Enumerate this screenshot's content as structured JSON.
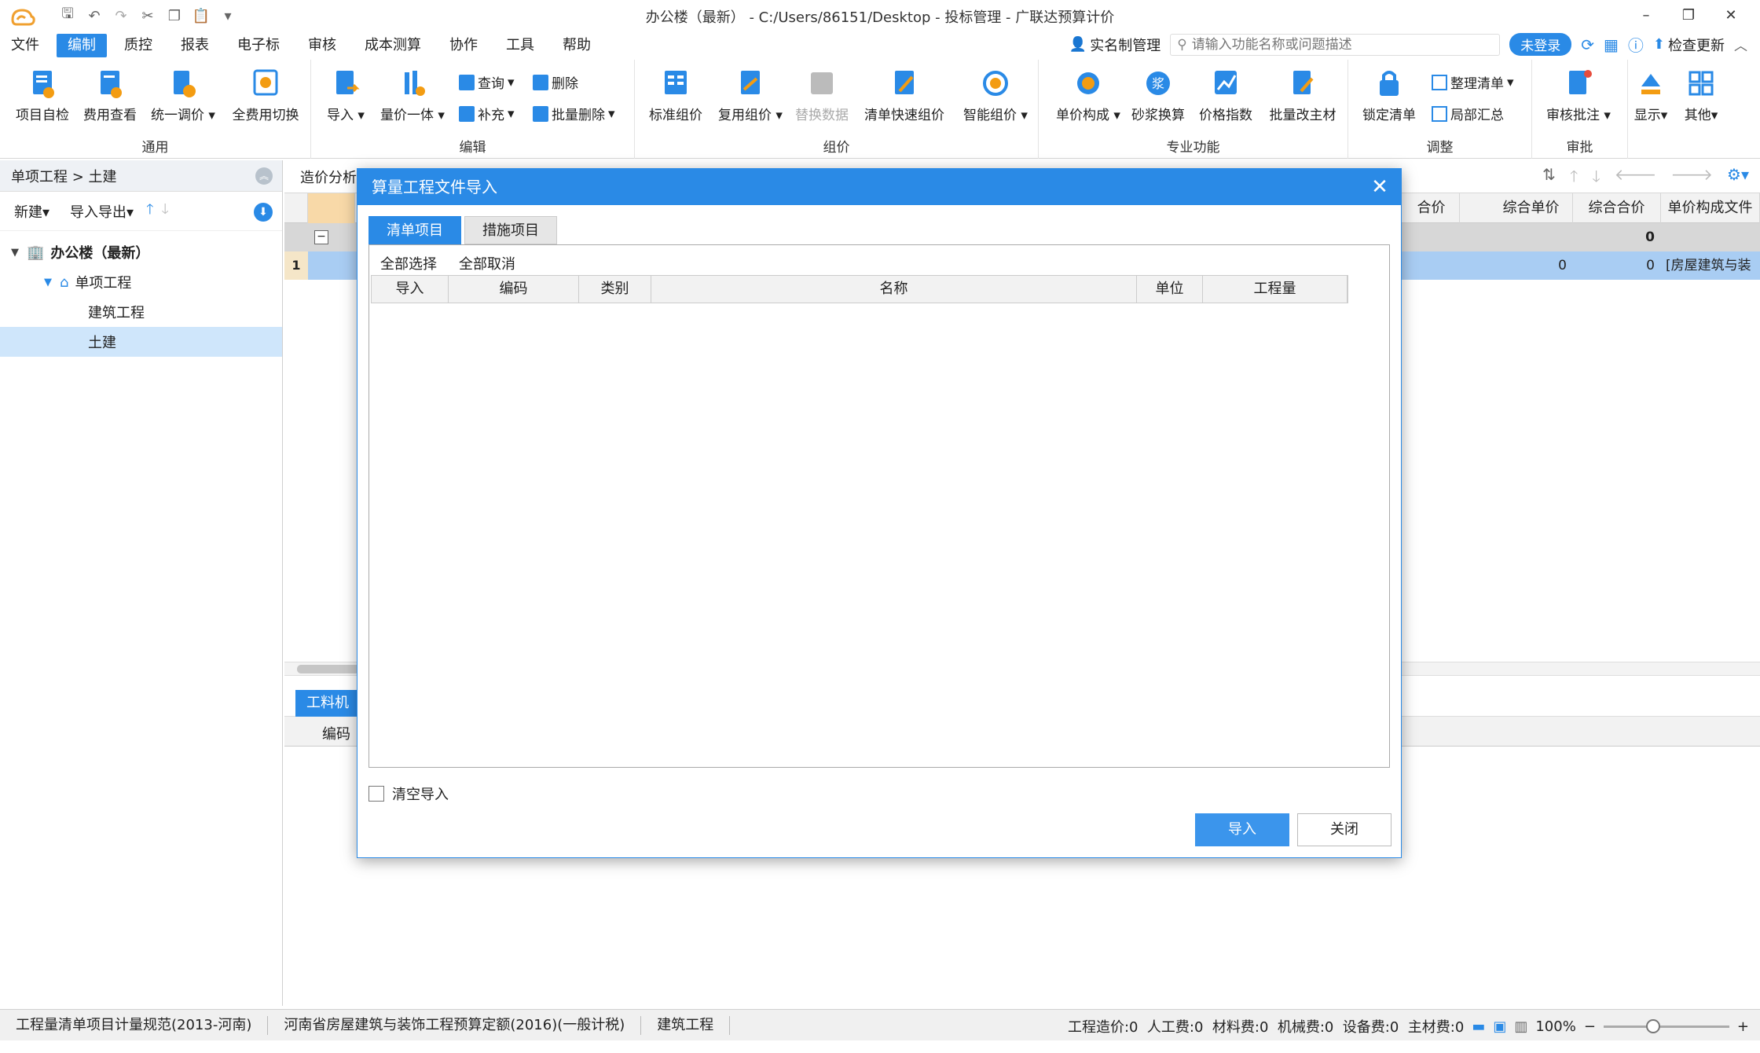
{
  "window": {
    "title": "办公楼（最新） - C:/Users/86151/Desktop - 投标管理 - 广联达预算计价",
    "buttons": [
      "–",
      "❐",
      "✕"
    ]
  },
  "menu": {
    "items": [
      "文件",
      "编制",
      "质控",
      "报表",
      "电子标",
      "审核",
      "成本测算",
      "协作",
      "工具",
      "帮助"
    ],
    "active_index": 1,
    "realname": "实名制管理",
    "search_placeholder": "请输入功能名称或问题描述",
    "login": "未登录",
    "check_update": "检查更新"
  },
  "ribbon": {
    "groups": {
      "general": "通用",
      "edit": "编辑",
      "pricing": "组价",
      "special": "专业功能",
      "adjust": "调整",
      "approve": "审批"
    },
    "general_buttons": [
      "项目自检",
      "费用查看",
      "统一调价",
      "全费用切换"
    ],
    "edit_buttons": [
      "导入",
      "量价一体"
    ],
    "edit_small": [
      "查询",
      "删除",
      "补充",
      "批量删除"
    ],
    "pricing_buttons": [
      "标准组价",
      "复用组价",
      "替换数据",
      "清单快速组价",
      "智能组价"
    ],
    "special_buttons": [
      "单价构成",
      "砂浆换算",
      "价格指数",
      "批量改主材"
    ],
    "adjust_buttons": [
      "锁定清单"
    ],
    "adjust_small": [
      "整理清单",
      "局部汇总"
    ],
    "approve_buttons": [
      "审核批注"
    ],
    "view_buttons": [
      "显示",
      "其他"
    ]
  },
  "left_panel": {
    "breadcrumb": "单项工程 > 土建",
    "tools": [
      "新建",
      "导入导出"
    ],
    "tree": [
      {
        "label": "办公楼（最新）",
        "level": 0
      },
      {
        "label": "单项工程",
        "level": 1
      },
      {
        "label": "建筑工程",
        "level": 2
      },
      {
        "label": "土建",
        "level": 2,
        "selected": true
      }
    ]
  },
  "main": {
    "tab": "造价分析",
    "headers": [
      "合价",
      "综合单价",
      "综合合价",
      "单价构成文件"
    ],
    "row0": {
      "total": "0"
    },
    "row1": {
      "num": "1",
      "unit_price": "0",
      "total": "0",
      "file": "[房屋建筑与装"
    },
    "bottom_tab": "工料机",
    "bottom_header": "编码"
  },
  "dialog": {
    "title": "算量工程文件导入",
    "tabs": [
      "清单项目",
      "措施项目"
    ],
    "active_tab": 0,
    "select_all": "全部选择",
    "deselect_all": "全部取消",
    "columns": [
      "导入",
      "编码",
      "类别",
      "名称",
      "单位",
      "工程量"
    ],
    "clear_import": "清空导入",
    "import_button": "导入",
    "close_button": "关闭"
  },
  "statusbar": {
    "items": [
      "工程量清单项目计量规范(2013-河南)",
      "河南省房屋建筑与装饰工程预算定额(2016)(一般计税)",
      "建筑工程"
    ],
    "costs": "工程造价:0  人工费:0  材料费:0  机械费:0  设备费:0  主材费:0",
    "zoom": "100%"
  }
}
